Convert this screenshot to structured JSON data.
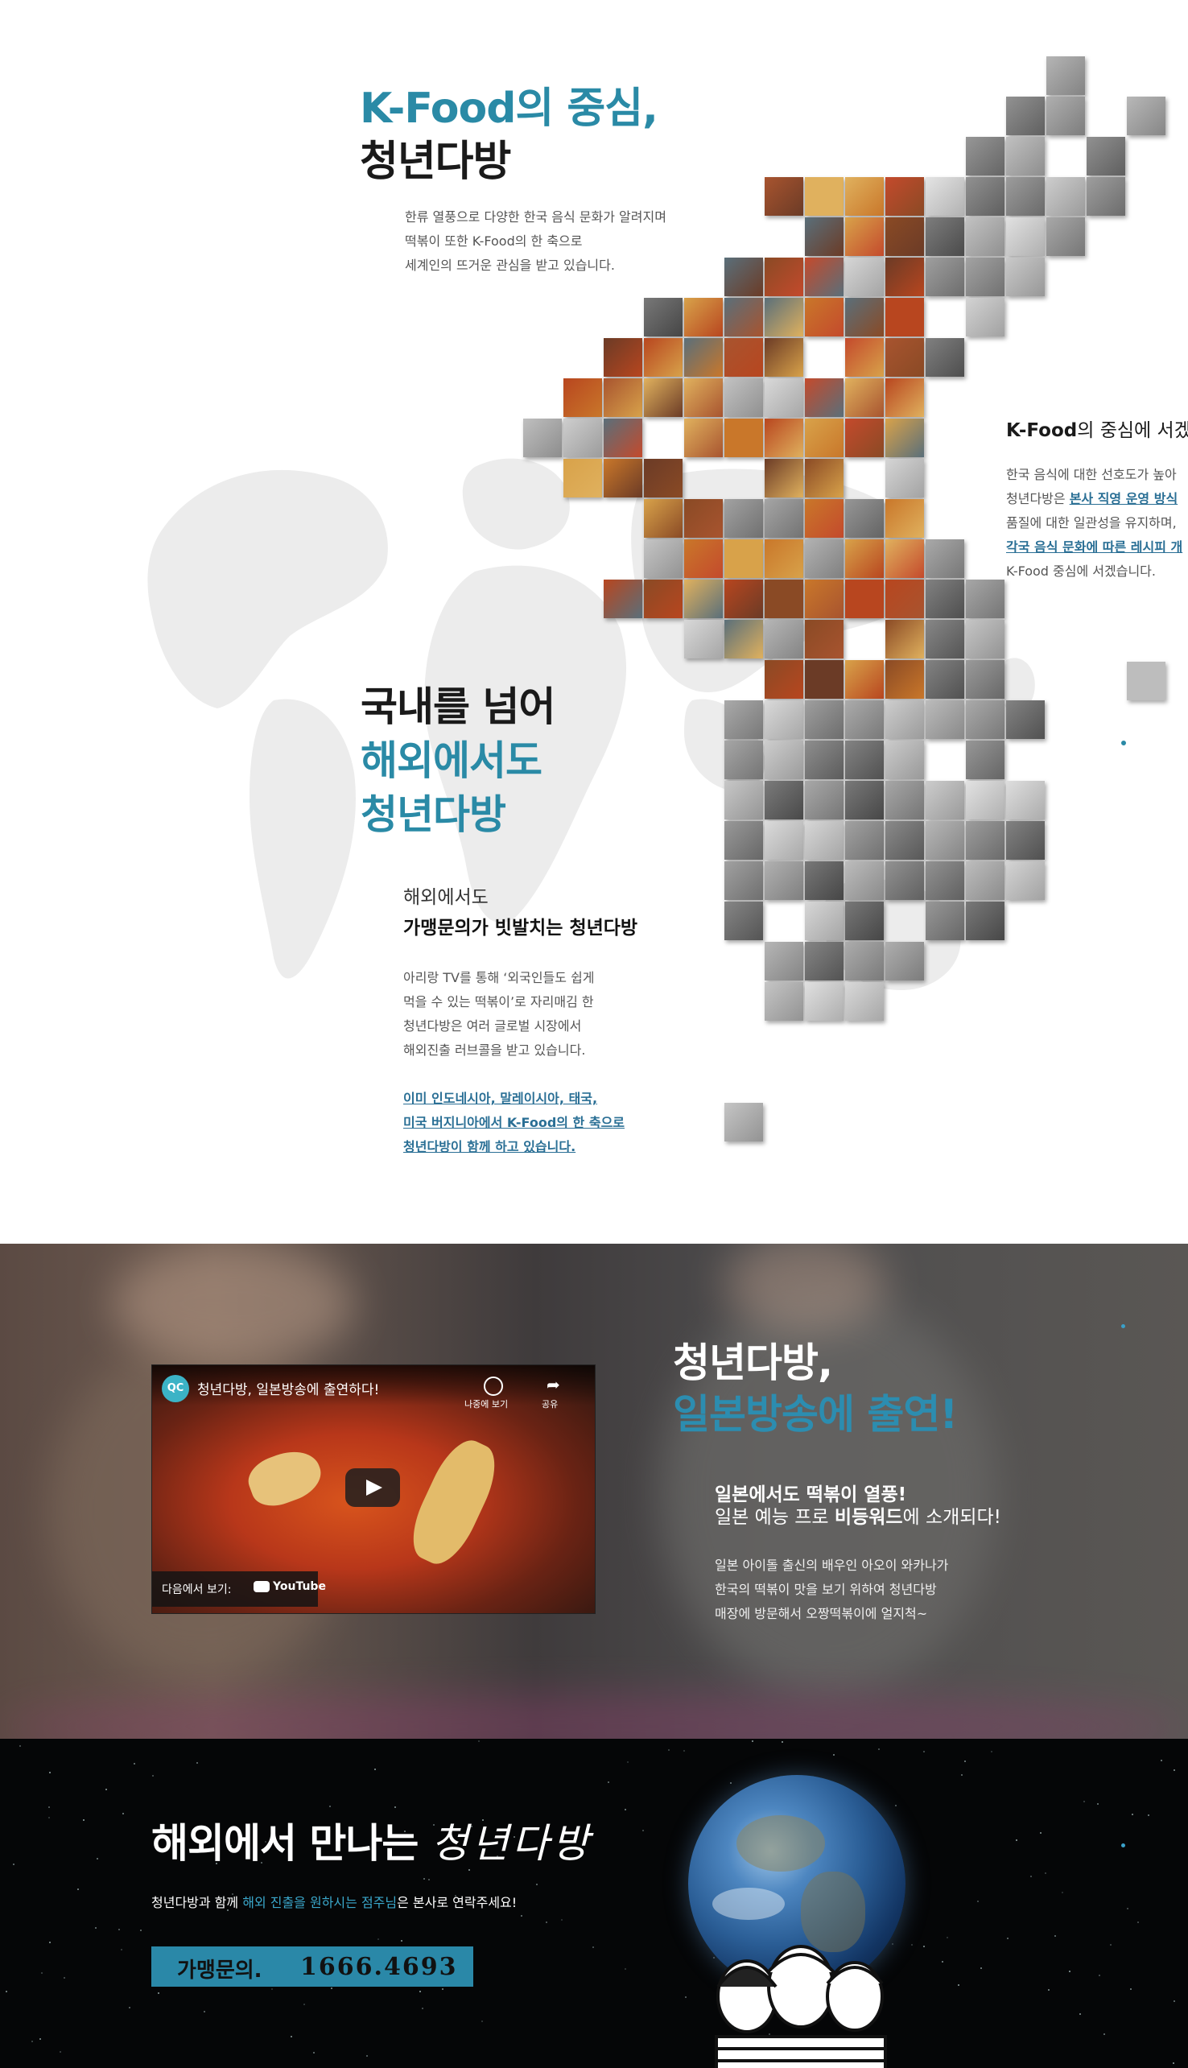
{
  "kfood": {
    "title_line1": "K-Food의 중심,",
    "title_line2": "청년다방",
    "desc": [
      "한류 열풍으로 다양한 한국 음식 문화가 알려지며",
      "떡볶이 또한 K-Food의 한 축으로",
      "세계인의 뜨거운 관심을 받고 있습니다."
    ],
    "side_title_bold": "K-Food",
    "side_title_rest": "의 중심에 서겠",
    "side_line1": "한국 음식에 대한 선호도가 높아",
    "side_line2_pre": "청년다방은 ",
    "side_line2_link": "본사 직영 운영 방식",
    "side_line3": "품질에 대한 일관성을 유지하며,",
    "side_line4_link": "각국 음식 문화에 따른 레시피 개",
    "side_line5": "K-Food 중심에 서겠습니다."
  },
  "overseas": {
    "title_line1": "국내를 넘어",
    "title_line2": "해외에서도",
    "title_line3": "청년다방",
    "sub_line1": "해외에서도",
    "sub_line2": "가맹문의가 빗발치는 청년다방",
    "desc": [
      "아리랑 TV를 통해 ‘외국인들도 쉽게",
      "먹을 수 있는 떡볶이’로 자리매김 한",
      "청년다방은 여러 글로벌 시장에서",
      "해외진출 러브콜을 받고 있습니다."
    ],
    "links": [
      "이미 인도네시아, 말레이시아, 태국,",
      "미국 버지니아에서 K-Food의 한 축으로",
      "청년다방이 함께 하고 있습니다."
    ]
  },
  "tv": {
    "title_line1": "청년다방,",
    "title_line2": "일본방송에 출연!",
    "sub_line1": "일본에서도 떡볶이 열풍!",
    "sub_line2_pre": "일본 예능 프로 ",
    "sub_line2_bold": "비등워드",
    "sub_line2_post": "에 소개되다!",
    "desc": [
      "일본 아이돌 출신의 배우인 아오이 와카나가",
      "한국의 떡볶이 맛을 보기 위하여 청년다방",
      "매장에 방문해서 오짱떡볶이에 얼지척~"
    ],
    "video": {
      "title": "청년다방, 일본방송에 출연하다!",
      "channel_badge": "QC",
      "later_label": "나중에 보기",
      "share_label": "공유",
      "watch_on": "다음에서 보기:",
      "youtube_label": "YouTube"
    }
  },
  "franchise": {
    "title": "해외에서 만나는 ",
    "title_brand": "청년다방",
    "desc_pre": "청년다방과 함께 ",
    "desc_link": "해외 진출을 원하시는 점주님",
    "desc_post": "은 본사로 연락주세요!",
    "phone_label": "가맹문의.",
    "phone_number": "1666.4693"
  }
}
